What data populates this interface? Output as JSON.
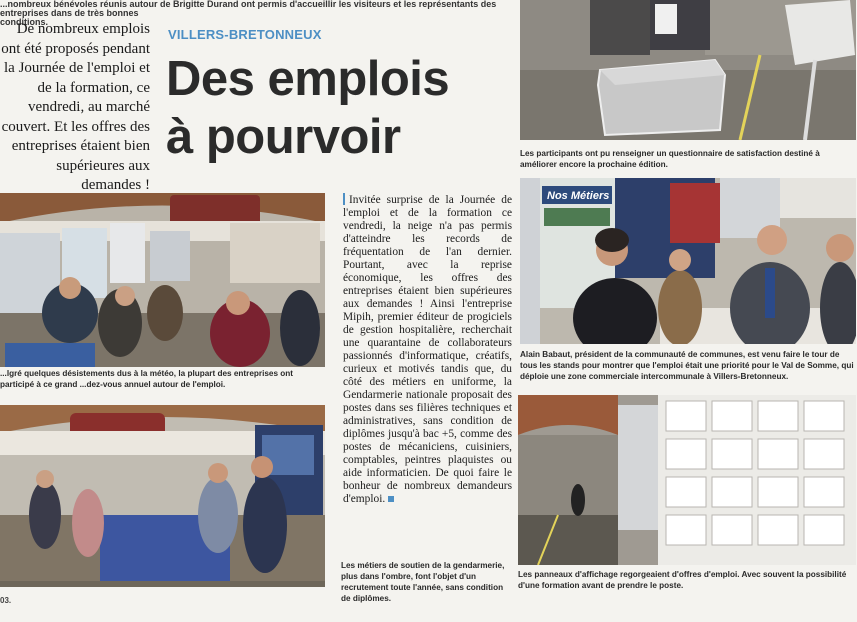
{
  "top_fragment": {
    "line1": "...nombreux bénévoles réunis autour de Brigitte Durand ont permis d'accueillir les visiteurs et les représentants des entreprises dans de très bonnes",
    "line2": "conditions."
  },
  "intro": "De nombreux emplois ont été proposés pendant la Journée de l'emploi et de la formation, ce vendredi, au marché couvert. Et les offres des entreprises étaient bien supérieures aux demandes !",
  "kicker": "VILLERS-BRETONNEUX",
  "headline": "Des emplois à pourvoir",
  "body": "Invitée surprise de la Journée de l'emploi et de la formation ce vendredi, la neige n'a pas permis d'atteindre les records de fréquentation de l'an dernier. Pourtant, avec la reprise économique, les offres des entreprises étaient bien supérieures aux demandes ! Ainsi l'entreprise Mipih, premier éditeur de progiciels de gestion hospitalière, recherchait une quarantaine de collaborateurs passionnés d'informatique, créatifs, curieux et motivés tandis que, du côté des métiers en uniforme, la Gendarmerie nationale proposait des postes dans ses filières techniques et administratives, sans condition de diplômes jusqu'à bac +5, comme des postes de mécaniciens, cuisiniers, comptables, peintres plaquistes ou aide informaticien. De quoi faire le bonheur de nombreux demandeurs d'emploi.",
  "captions": {
    "hall": "...lgré quelques désistements dus à la météo, la plupart des entreprises ont participé à ce grand ...dez-vous annuel autour de l'emploi.",
    "gendarmerie": "Les métiers de soutien de la gendarmerie, plus dans l'ombre, font l'objet d'un recrutement toute l'année, sans condition de diplômes.",
    "survey": "Les participants ont pu renseigner un questionnaire de satisfaction destiné à améliorer encore la prochaine édition.",
    "babaut": "Alain Babaut, président de la communauté de communes, est venu faire le tour de tous les stands pour montrer que l'emploi était une priorité pour le Val de Somme, qui déploie une zone commerciale intercommunale à Villers-Bretonneux.",
    "board": "Les panneaux d'affichage regorgeaient d'offres d'emploi. Avec souvent la possibilité d'une formation avant de prendre le poste."
  },
  "photo_signs": {
    "nos_metiers": "Nos Métiers"
  },
  "page_number": "03."
}
